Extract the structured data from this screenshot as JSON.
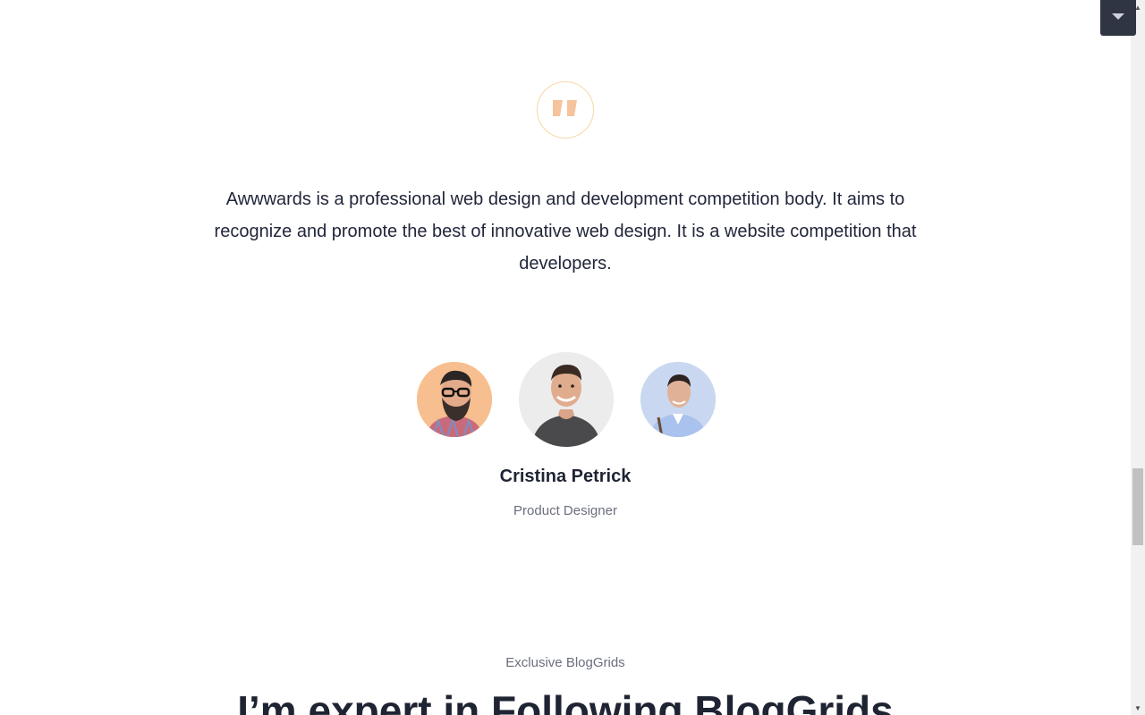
{
  "testimonial": {
    "icon": "quote-icon",
    "text": "Awwwards is a professional web design and development competition body. It aims to recognize and promote the best of innovative web design. It is a website competition that developers.",
    "author_name": "Cristina Petrick",
    "author_role": "Product Designer",
    "avatars": [
      "avatar-bearded-man",
      "avatar-smiling-man",
      "avatar-man-shirt"
    ]
  },
  "section": {
    "eyebrow": "Exclusive BlogGrids",
    "heading": "I’m expert in Following BlogGrids"
  },
  "scrollbar": {
    "up_icon": "arrow-up-icon",
    "down_icon": "arrow-down-icon"
  },
  "float_button": {
    "icon": "caret-down-icon"
  },
  "colors": {
    "quote_accent": "#f5c39c",
    "quote_ring": "#f4d9a8",
    "heading": "#1f2433",
    "muted": "#6b6f7e",
    "float_button_bg": "#2f3542"
  }
}
